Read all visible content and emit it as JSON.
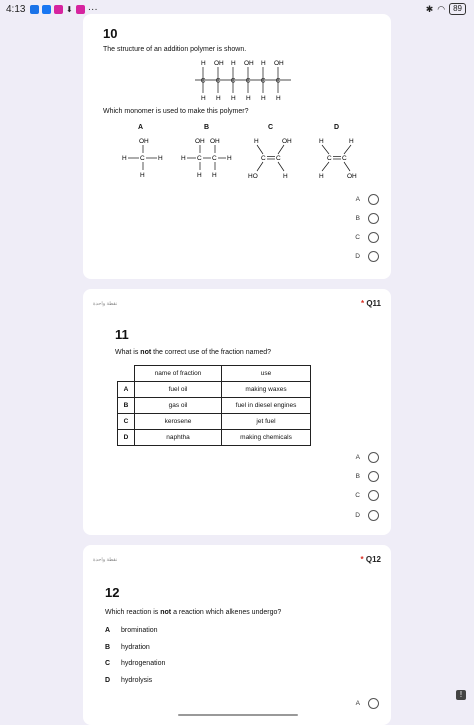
{
  "status_bar": {
    "time": "4:13",
    "battery": "89",
    "more": "···"
  },
  "q10": {
    "number": "10",
    "text": "The structure of an addition polymer is shown.",
    "question": "Which monomer is used to make this polymer?",
    "polymer_top": [
      "H",
      "OH",
      "H",
      "OH",
      "H",
      "OH"
    ],
    "polymer_bottom": [
      "H",
      "H",
      "H",
      "H",
      "H",
      "H"
    ],
    "monomer_labels": [
      "A",
      "B",
      "C",
      "D"
    ],
    "monomer_a": {
      "top": "OH",
      "left": "H",
      "bottom": "H",
      "right": "H"
    },
    "monomer_b": {
      "top1": "OH",
      "top2": "OH",
      "left": "H",
      "right": "H",
      "bottom1": "H",
      "bottom2": "H"
    },
    "monomer_c": {
      "tl": "H",
      "tr": "OH",
      "bl": "HO",
      "br": "H"
    },
    "monomer_d": {
      "tl": "H",
      "tr": "H",
      "bl": "H",
      "br": "OH"
    },
    "options": [
      "A",
      "B",
      "C",
      "D"
    ]
  },
  "q11": {
    "points": "نقطة واحدة",
    "label": "Q11",
    "number": "11",
    "text_pre": "What is ",
    "text_bold": "not",
    "text_post": " the correct use of the fraction named?",
    "headers": [
      "name of fraction",
      "use"
    ],
    "rows": [
      {
        "key": "A",
        "fraction": "fuel oil",
        "use": "making waxes"
      },
      {
        "key": "B",
        "fraction": "gas oil",
        "use": "fuel in diesel engines"
      },
      {
        "key": "C",
        "fraction": "kerosene",
        "use": "jet fuel"
      },
      {
        "key": "D",
        "fraction": "naphtha",
        "use": "making chemicals"
      }
    ],
    "options": [
      "A",
      "B",
      "C",
      "D"
    ]
  },
  "q12": {
    "points": "نقطة واحدة",
    "label": "Q12",
    "number": "12",
    "text_pre": "Which reaction is ",
    "text_bold": "not",
    "text_post": " a reaction which alkenes undergo?",
    "choices": [
      {
        "key": "A",
        "text": "bromination"
      },
      {
        "key": "B",
        "text": "hydration"
      },
      {
        "key": "C",
        "text": "hydrogenation"
      },
      {
        "key": "D",
        "text": "hydrolysis"
      }
    ],
    "options": [
      "A"
    ]
  }
}
